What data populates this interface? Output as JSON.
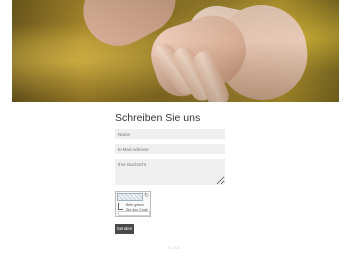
{
  "hero": {
    "image": "holding-hands-photo"
  },
  "contact": {
    "heading": "Schreiben Sie uns",
    "name_placeholder": "Name",
    "email_placeholder": "E-Mail-Adresse",
    "message_placeholder": "Ihre Nachricht",
    "captcha_text": "Bitte geben Sie den Code ein",
    "submit_label": "Senden"
  },
  "footer": {
    "text": "© 2016"
  },
  "colors": {
    "button_bg": "#4a4a4a",
    "field_bg": "#efefef",
    "heading": "#333333"
  }
}
